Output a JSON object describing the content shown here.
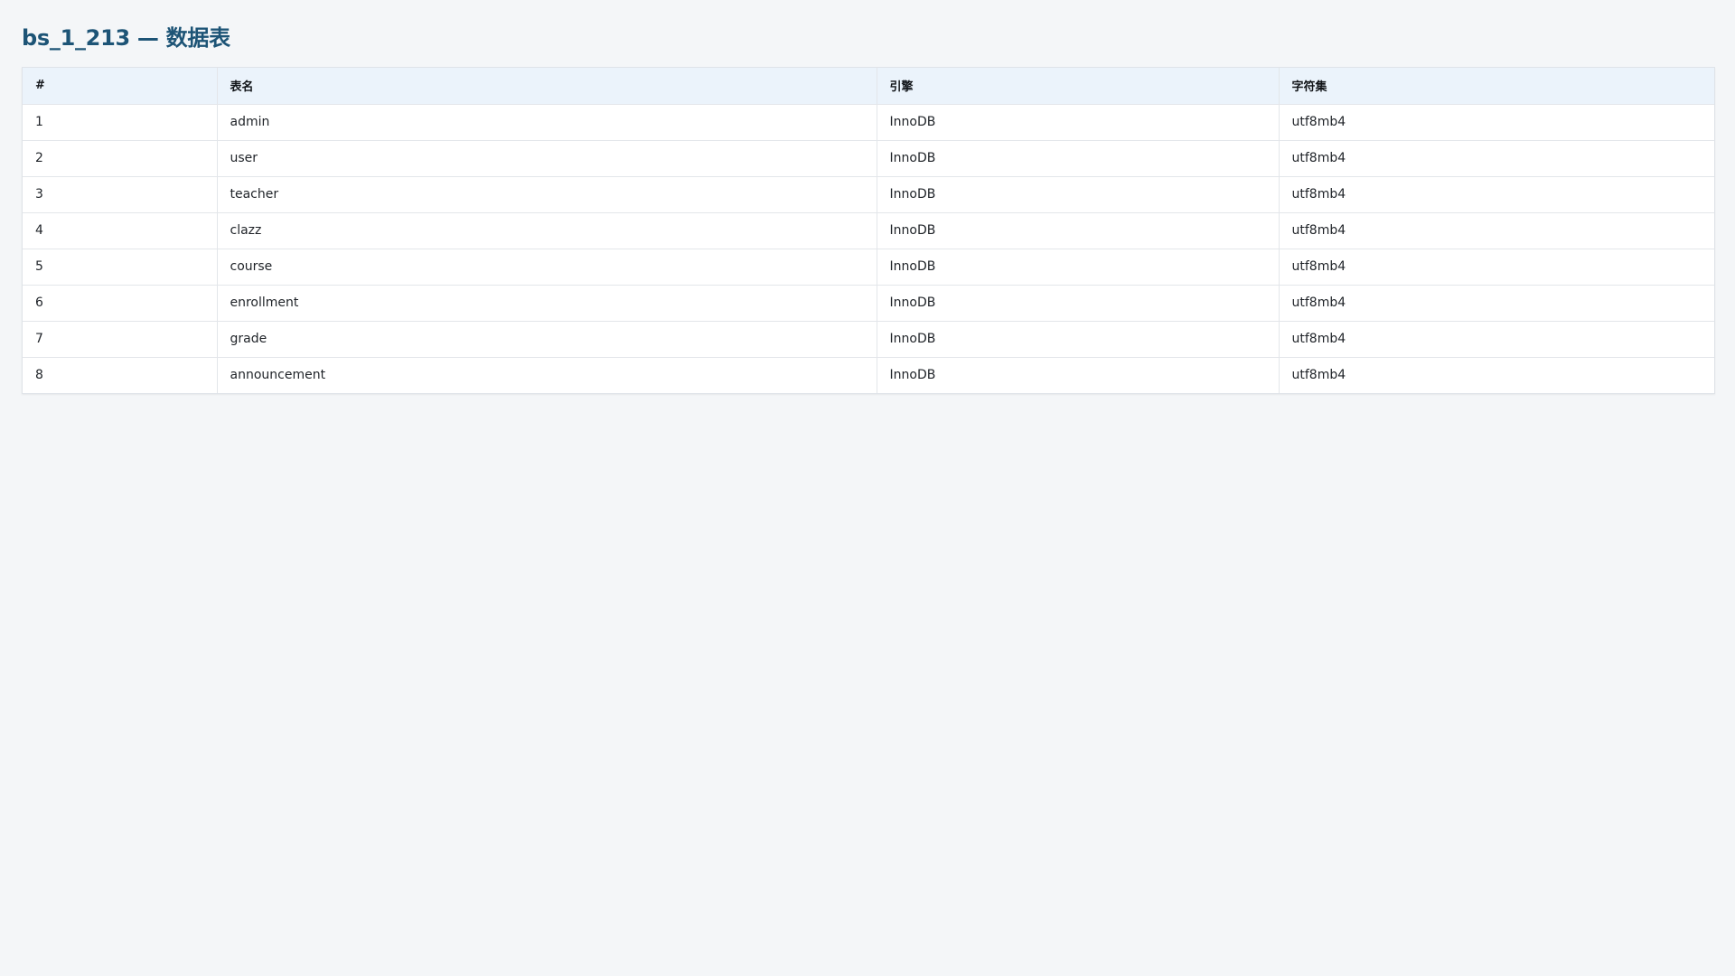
{
  "page": {
    "title": "bs_1_213 — 数据表"
  },
  "table": {
    "columns": [
      "#",
      "表名",
      "引擎",
      "字符集"
    ],
    "rows": [
      [
        "1",
        "admin",
        "InnoDB",
        "utf8mb4"
      ],
      [
        "2",
        "user",
        "InnoDB",
        "utf8mb4"
      ],
      [
        "3",
        "teacher",
        "InnoDB",
        "utf8mb4"
      ],
      [
        "4",
        "clazz",
        "InnoDB",
        "utf8mb4"
      ],
      [
        "5",
        "course",
        "InnoDB",
        "utf8mb4"
      ],
      [
        "6",
        "enrollment",
        "InnoDB",
        "utf8mb4"
      ],
      [
        "7",
        "grade",
        "InnoDB",
        "utf8mb4"
      ],
      [
        "8",
        "announcement",
        "InnoDB",
        "utf8mb4"
      ]
    ]
  },
  "colors": {
    "title": "#1d5476",
    "header_bg": "#ebf3fb",
    "page_bg": "#f4f6f8",
    "border": "#e3e6ea"
  }
}
